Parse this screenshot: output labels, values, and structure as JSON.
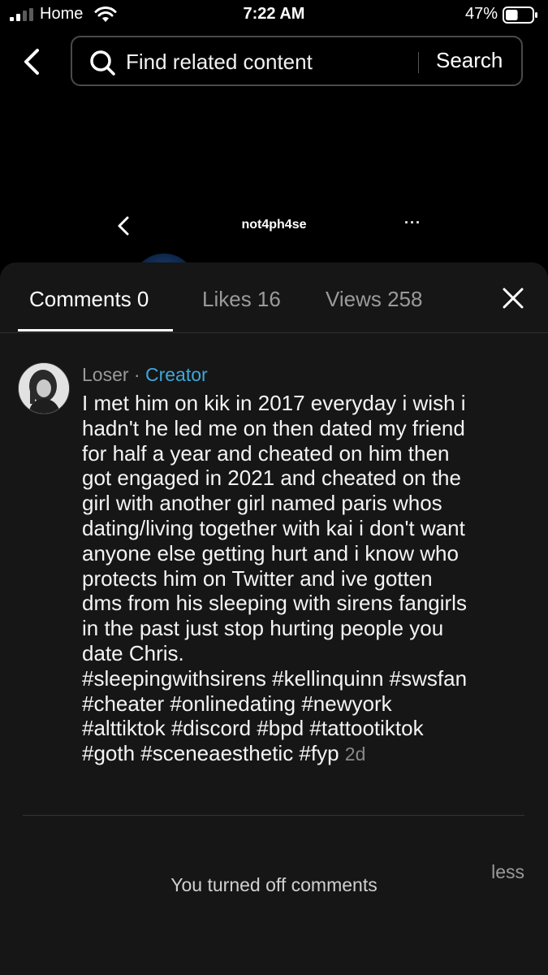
{
  "status_bar": {
    "carrier": "Home",
    "time": "7:22 AM",
    "battery_percent": "47%",
    "battery_level": 0.47,
    "icons": [
      "signal-icon",
      "wifi-icon",
      "battery-icon"
    ]
  },
  "search_bar": {
    "placeholder": "Find related content",
    "button_label": "Search",
    "icons": [
      "back-icon",
      "search-icon"
    ]
  },
  "video_header": {
    "username": "not4ph4se",
    "more_label": "···",
    "icons": [
      "back-icon",
      "more-icon"
    ]
  },
  "panel": {
    "tabs": [
      {
        "label": "Comments 0",
        "active": true
      },
      {
        "label": "Likes 16",
        "active": false
      },
      {
        "label": "Views 258",
        "active": false
      }
    ],
    "close_icon": "close-icon"
  },
  "comment": {
    "author": "Loser",
    "separator": " · ",
    "badge": "Creator",
    "text": "I met him on kik in 2017 everyday i wish i\nhadn't he led me on then dated my friend\nfor half a year and cheated on him then\ngot engaged in 2021 and cheated on the\ngirl with another girl named paris whos\ndating/living together with kai i don't want\nanyone else getting hurt and i know who\nprotects him on Twitter and ive gotten\ndms from his sleeping with sirens fangirls\nin the past just stop hurting people you\ndate Chris.\n#sleepingwithsirens #kellinquinn #swsfan\n#cheater #onlinedating #newyork\n#alttiktok #discord #bpd #tattootiktok\n#goth #sceneaesthetic #fyp",
    "time": "2d",
    "less_label": "less"
  },
  "footer": {
    "comments_off_message": "You turned off comments"
  },
  "colors": {
    "background": "#000000",
    "sheet": "#161616",
    "creator_badge": "#3ea8d8",
    "muted_text": "#9a9a9a"
  }
}
